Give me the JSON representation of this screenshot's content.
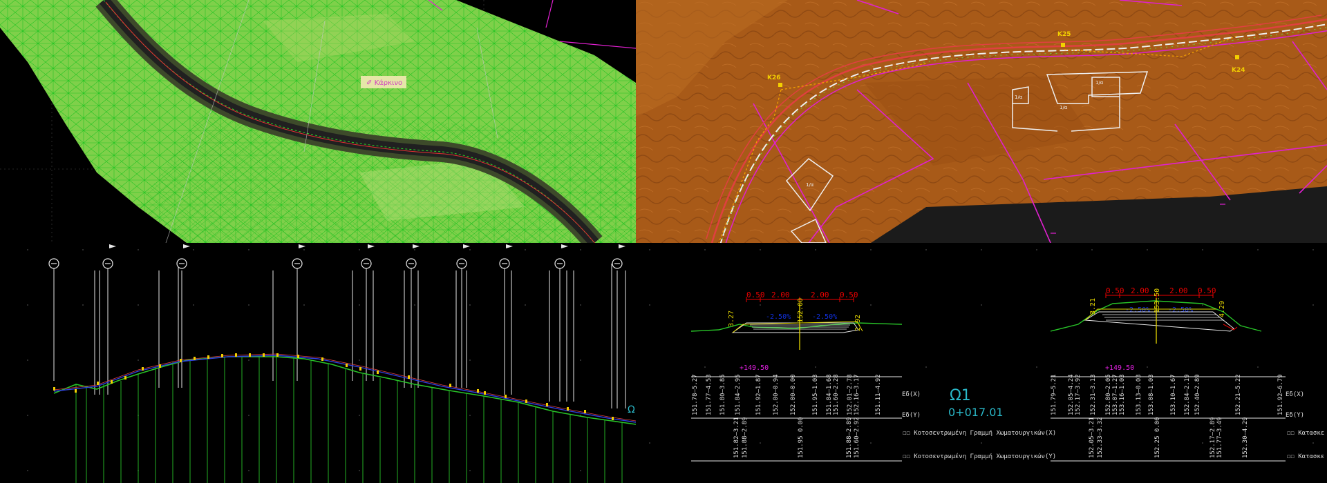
{
  "views": {
    "terrain_3d": {
      "label_glyph": "✐",
      "label_text": "Κάρκινο"
    },
    "plan_view": {
      "nodes": [
        "K25",
        "K26",
        "K24"
      ],
      "building_labels": [
        "1/α",
        "1/α",
        "1/α",
        "1/α"
      ]
    },
    "long_section": {
      "end_label": "Ω1"
    },
    "cross_sections": {
      "left": {
        "red_dims": [
          "0.50",
          "2.00",
          "2.00",
          "0.50"
        ],
        "slopes": [
          "-2.50%",
          "-2.50%"
        ],
        "left_height": "3.27",
        "right_height": "2.92",
        "center_elev": "152.00",
        "tick": "+149.50",
        "rows_e": [
          "151.78—5.27",
          "151.77—4.53",
          "151.80—3.85",
          "151.84—2.95",
          "151.92—1.87",
          "152.00—0.94",
          "152.00—0.00",
          "151.95—1.03",
          "151.84—1.68",
          "151.60—2.28",
          "152.01—2.78",
          "152.16—3.17",
          "151.11—4.92"
        ],
        "rows_bottom": [
          "151.82—3.21",
          "151.88—2.89",
          "151.95 0.00",
          "151.88—2.89",
          "151.60—2.92"
        ]
      },
      "right": {
        "red_dims": [
          "0.50",
          "2.00",
          "2.00",
          "0.50"
        ],
        "slopes": [
          "-2.50%",
          "-2.50%"
        ],
        "left_height": "3.21",
        "right_height": "4.29",
        "center_elev": "153.50",
        "tick": "+149.50",
        "rows_e": [
          "151.79—5.21",
          "152.05—4.24",
          "152.17—3.92",
          "152.31—3.13",
          "152.80—2.05",
          "153.07—1.27",
          "153.16—1.03",
          "153.13—0.03",
          "153.08—1.03",
          "153.10—1.67",
          "152.84—2.19",
          "152.40—2.89",
          "152.21—5.22",
          "151.92—6.79"
        ],
        "rows_bottom": [
          "152.05—3.21",
          "152.33—3.32",
          "152.25 0.00",
          "152.17—2.89",
          "151.77—3.49",
          "152.30—4.29"
        ]
      },
      "axis_labels": [
        "Eδ(X)",
        "Eδ(Y)"
      ],
      "station_name": "Ω1",
      "station_chainage": "0+017.01",
      "footer_rows": [
        "☐☐ Κοτοσεντρωμένη Γραμμή Χωματουργικών(X)",
        "☐☐ Κοτοσεντρωμένη Γραμμή Χωματουργικών(Y)"
      ],
      "cut_text": "☐☐ Κατασκε"
    }
  },
  "colors": {
    "terrain_green": "#7fd04a",
    "mesh_green": "#22c422",
    "plan_orange": "#a85a18",
    "boundary_magenta": "#e020d0",
    "road_red": "#e04040",
    "profile_green": "#28c428",
    "accent_yellow": "#f2d000",
    "station_cyan": "#2ab8c8"
  }
}
